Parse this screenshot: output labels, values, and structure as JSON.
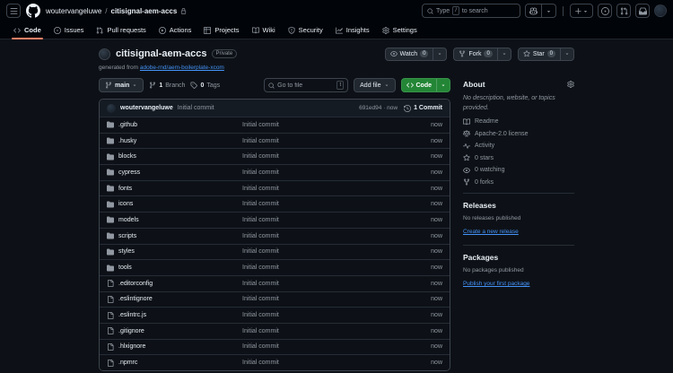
{
  "header": {
    "owner": "woutervangeluwe",
    "separator": "/",
    "repo": "citisignal-aem-accs",
    "search": {
      "word1": "Type",
      "key": "/",
      "word2": "to search"
    }
  },
  "nav": {
    "tabs": [
      {
        "label": "Code",
        "icon": "code",
        "active": true
      },
      {
        "label": "Issues",
        "icon": "issue"
      },
      {
        "label": "Pull requests",
        "icon": "pr"
      },
      {
        "label": "Actions",
        "icon": "play"
      },
      {
        "label": "Projects",
        "icon": "table"
      },
      {
        "label": "Wiki",
        "icon": "book"
      },
      {
        "label": "Security",
        "icon": "shield"
      },
      {
        "label": "Insights",
        "icon": "graph"
      },
      {
        "label": "Settings",
        "icon": "gear"
      }
    ]
  },
  "repo": {
    "name": "citisignal-aem-accs",
    "visibility": "Private",
    "generated_prefix": "generated from",
    "generated_link": "adobe-rnd/aem-boilerplate-xcom",
    "actions": [
      {
        "label": "Watch",
        "icon": "eye",
        "count": "0"
      },
      {
        "label": "Fork",
        "icon": "fork",
        "count": "0"
      },
      {
        "label": "Star",
        "icon": "star",
        "count": "0"
      }
    ]
  },
  "toolbar": {
    "branch": "main",
    "branches": {
      "count": "1",
      "label": "Branch"
    },
    "tags": {
      "count": "0",
      "label": "Tags"
    },
    "goto_placeholder": "Go to file",
    "goto_key": "t",
    "add_file": "Add file",
    "code": "Code"
  },
  "commit_bar": {
    "author": "woutervangeluwe",
    "message": "Initial commit",
    "sha_line": "691ed94 · now",
    "count": "1 Commit"
  },
  "files": [
    {
      "name": ".github",
      "icon": "folder",
      "message": "Initial commit",
      "time": "now"
    },
    {
      "name": ".husky",
      "icon": "folder",
      "message": "Initial commit",
      "time": "now"
    },
    {
      "name": "blocks",
      "icon": "folder",
      "message": "Initial commit",
      "time": "now"
    },
    {
      "name": "cypress",
      "icon": "folder",
      "message": "Initial commit",
      "time": "now"
    },
    {
      "name": "fonts",
      "icon": "folder",
      "message": "Initial commit",
      "time": "now"
    },
    {
      "name": "icons",
      "icon": "folder",
      "message": "Initial commit",
      "time": "now"
    },
    {
      "name": "models",
      "icon": "folder",
      "message": "Initial commit",
      "time": "now"
    },
    {
      "name": "scripts",
      "icon": "folder",
      "message": "Initial commit",
      "time": "now"
    },
    {
      "name": "styles",
      "icon": "folder",
      "message": "Initial commit",
      "time": "now"
    },
    {
      "name": "tools",
      "icon": "folder",
      "message": "Initial commit",
      "time": "now"
    },
    {
      "name": ".editorconfig",
      "icon": "file",
      "message": "Initial commit",
      "time": "now"
    },
    {
      "name": ".eslintignore",
      "icon": "file",
      "message": "Initial commit",
      "time": "now"
    },
    {
      "name": ".eslintrc.js",
      "icon": "file",
      "message": "Initial commit",
      "time": "now"
    },
    {
      "name": ".gitignore",
      "icon": "file",
      "message": "Initial commit",
      "time": "now"
    },
    {
      "name": ".hlxignore",
      "icon": "file",
      "message": "Initial commit",
      "time": "now"
    },
    {
      "name": ".npmrc",
      "icon": "file",
      "message": "Initial commit",
      "time": "now"
    }
  ],
  "sidebar": {
    "about": {
      "title": "About",
      "description": "No description, website, or topics provided.",
      "items": [
        {
          "label": "Readme",
          "icon": "book"
        },
        {
          "label": "Apache-2.0 license",
          "icon": "law"
        },
        {
          "label": "Activity",
          "icon": "pulse"
        },
        {
          "label": "0 stars",
          "icon": "star"
        },
        {
          "label": "0 watching",
          "icon": "eye"
        },
        {
          "label": "0 forks",
          "icon": "fork"
        }
      ]
    },
    "releases": {
      "title": "Releases",
      "empty": "No releases published",
      "link": "Create a new release"
    },
    "packages": {
      "title": "Packages",
      "empty": "No packages published",
      "link": "Publish your first package"
    }
  },
  "colors": {
    "header_bg": "#010409",
    "body_bg": "#0d1117",
    "accent_green": "#238636",
    "tab_underline": "#f78166",
    "link_blue": "#4493f8",
    "muted_text": "#9198a1"
  }
}
